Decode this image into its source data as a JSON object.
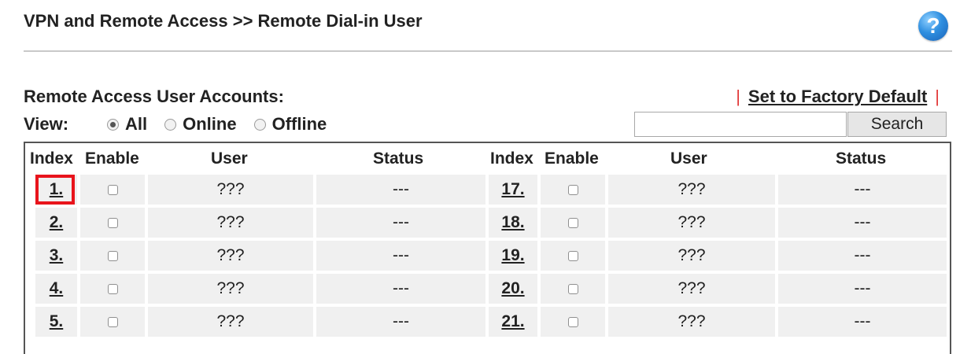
{
  "page_title": "VPN and Remote Access >> Remote Dial-in User",
  "help_icon": "?",
  "section_label": "Remote Access User Accounts:",
  "factory_separator": "|",
  "factory_link": "Set to Factory Default",
  "view": {
    "label": "View:",
    "options": [
      "All",
      "Online",
      "Offline"
    ],
    "selected": "All"
  },
  "search": {
    "value": "",
    "button_label": "Search"
  },
  "table": {
    "headers": [
      "Index",
      "Enable",
      "User",
      "Status",
      "Index",
      "Enable",
      "User",
      "Status"
    ],
    "rows": [
      {
        "left": {
          "index": "1.",
          "enabled": false,
          "user": "???",
          "status": "---"
        },
        "right": {
          "index": "17.",
          "enabled": false,
          "user": "???",
          "status": "---"
        }
      },
      {
        "left": {
          "index": "2.",
          "enabled": false,
          "user": "???",
          "status": "---"
        },
        "right": {
          "index": "18.",
          "enabled": false,
          "user": "???",
          "status": "---"
        }
      },
      {
        "left": {
          "index": "3.",
          "enabled": false,
          "user": "???",
          "status": "---"
        },
        "right": {
          "index": "19.",
          "enabled": false,
          "user": "???",
          "status": "---"
        }
      },
      {
        "left": {
          "index": "4.",
          "enabled": false,
          "user": "???",
          "status": "---"
        },
        "right": {
          "index": "20.",
          "enabled": false,
          "user": "???",
          "status": "---"
        }
      },
      {
        "left": {
          "index": "5.",
          "enabled": false,
          "user": "???",
          "status": "---"
        },
        "right": {
          "index": "21.",
          "enabled": false,
          "user": "???",
          "status": "---"
        }
      }
    ]
  },
  "colors": {
    "highlight": "#e8141c",
    "separator": "#e23a3a",
    "row_bg": "#f0f0f0"
  }
}
